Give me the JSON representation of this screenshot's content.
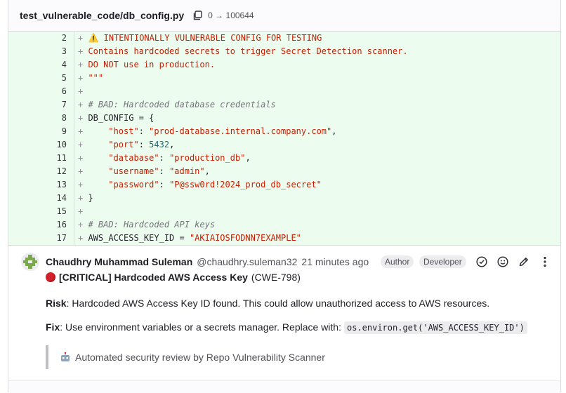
{
  "file": {
    "path": "test_vulnerable_code/db_config.py",
    "mode_change": "0 → 100644"
  },
  "diff": {
    "lines": [
      {
        "num": "2",
        "parts": [
          {
            "t": "⚠️",
            "cls": "warn"
          },
          {
            "t": " INTENTIONALLY VULNERABLE CONFIG FOR TESTING",
            "cls": "s"
          }
        ]
      },
      {
        "num": "3",
        "parts": [
          {
            "t": "Contains hardcoded secrets to trigger Secret Detection scanner.",
            "cls": "s"
          }
        ]
      },
      {
        "num": "4",
        "parts": [
          {
            "t": "DO NOT use in production.",
            "cls": "s"
          }
        ]
      },
      {
        "num": "5",
        "parts": [
          {
            "t": "\"\"\"",
            "cls": "s"
          }
        ]
      },
      {
        "num": "6",
        "parts": []
      },
      {
        "num": "7",
        "parts": [
          {
            "t": "# BAD: Hardcoded database credentials",
            "cls": "c"
          }
        ]
      },
      {
        "num": "8",
        "parts": [
          {
            "t": "DB_CONFIG = {",
            "cls": "p"
          }
        ]
      },
      {
        "num": "9",
        "parts": [
          {
            "t": "    ",
            "cls": "p"
          },
          {
            "t": "\"host\"",
            "cls": "s"
          },
          {
            "t": ": ",
            "cls": "p"
          },
          {
            "t": "\"prod-database.internal.company.com\"",
            "cls": "s"
          },
          {
            "t": ",",
            "cls": "p"
          }
        ]
      },
      {
        "num": "10",
        "parts": [
          {
            "t": "    ",
            "cls": "p"
          },
          {
            "t": "\"port\"",
            "cls": "s"
          },
          {
            "t": ": ",
            "cls": "p"
          },
          {
            "t": "5432",
            "cls": "n"
          },
          {
            "t": ",",
            "cls": "p"
          }
        ]
      },
      {
        "num": "11",
        "parts": [
          {
            "t": "    ",
            "cls": "p"
          },
          {
            "t": "\"database\"",
            "cls": "s"
          },
          {
            "t": ": ",
            "cls": "p"
          },
          {
            "t": "\"production_db\"",
            "cls": "s"
          },
          {
            "t": ",",
            "cls": "p"
          }
        ]
      },
      {
        "num": "12",
        "parts": [
          {
            "t": "    ",
            "cls": "p"
          },
          {
            "t": "\"username\"",
            "cls": "s"
          },
          {
            "t": ": ",
            "cls": "p"
          },
          {
            "t": "\"admin\"",
            "cls": "s"
          },
          {
            "t": ",",
            "cls": "p"
          }
        ]
      },
      {
        "num": "13",
        "parts": [
          {
            "t": "    ",
            "cls": "p"
          },
          {
            "t": "\"password\"",
            "cls": "s"
          },
          {
            "t": ": ",
            "cls": "p"
          },
          {
            "t": "\"P@ssw0rd!2024_prod_db_secret\"",
            "cls": "s"
          }
        ]
      },
      {
        "num": "14",
        "parts": [
          {
            "t": "}",
            "cls": "p"
          }
        ]
      },
      {
        "num": "15",
        "parts": []
      },
      {
        "num": "16",
        "parts": [
          {
            "t": "# BAD: Hardcoded API keys",
            "cls": "c"
          }
        ]
      },
      {
        "num": "17",
        "parts": [
          {
            "t": "AWS_ACCESS_KEY_ID = ",
            "cls": "p"
          },
          {
            "t": "\"AKIAIOSFODNN7EXAMPLE\"",
            "cls": "s"
          }
        ]
      }
    ]
  },
  "note": {
    "author": "Chaudhry Muhammad Suleman",
    "username": "@chaudhry.suleman32",
    "time": "21 minutes ago",
    "badges": {
      "author": "Author",
      "role": "Developer"
    },
    "title_bold": "[CRITICAL] Hardcoded AWS Access Key",
    "title_cwe": "(CWE-798)",
    "risk_label": "Risk",
    "risk_text": ": Hardcoded AWS Access Key ID found. This could allow unauthorized access to AWS resources.",
    "fix_label": "Fix",
    "fix_text": ": Use environment variables or a secrets manager. Replace with:",
    "fix_code": "os.environ.get('AWS_ACCESS_KEY_ID')",
    "quote": "Automated security review by Repo Vulnerability Scanner"
  },
  "colors": {
    "diff_added_bg": "#ecfdf0",
    "string": "#c91c00",
    "comment": "#737278",
    "number": "#1f6b75",
    "critical": "#d3202a"
  },
  "icons": [
    "copy-icon",
    "resolve-check-icon",
    "emoji-icon",
    "pencil-icon",
    "more-actions-icon",
    "robot-icon",
    "warning-icon",
    "critical-dot-icon"
  ]
}
